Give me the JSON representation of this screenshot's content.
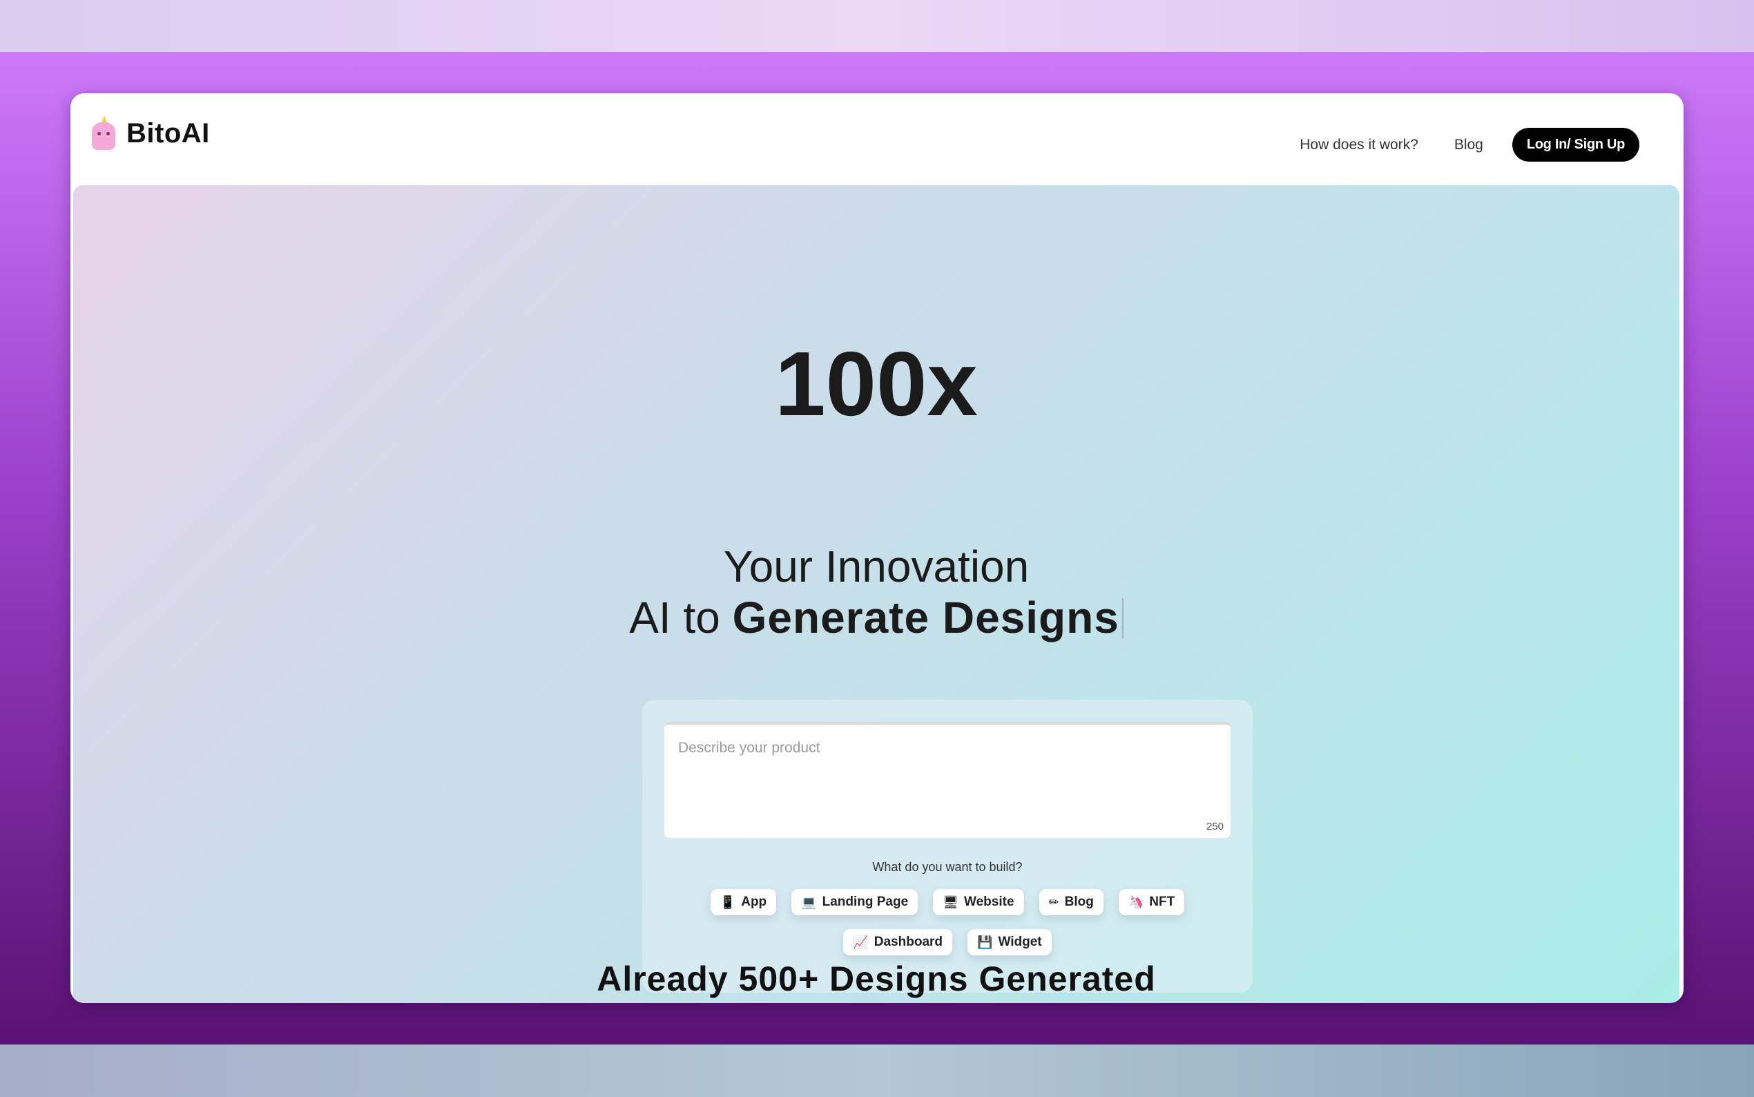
{
  "brand": {
    "name": "BitoAI",
    "logo_icon": "unicorn-icon"
  },
  "nav": {
    "links": [
      "How does it work?",
      "Blog"
    ],
    "login_label": "Log In/ Sign Up"
  },
  "hero": {
    "multiplier": "100x",
    "line1": "Your Innovation",
    "line2_prefix": "AI to",
    "line2_highlight": "Generate Designs"
  },
  "form": {
    "placeholder": "Describe your product",
    "char_counter": "250",
    "question": "What do you want to build?",
    "options_row1": [
      {
        "icon": "📱",
        "label": "App"
      },
      {
        "icon": "💻",
        "label": "Landing Page"
      },
      {
        "icon": "🖥",
        "label": "Website"
      },
      {
        "icon": "✏",
        "label": "Blog"
      },
      {
        "icon": "🦄",
        "label": "NFT"
      }
    ],
    "options_row2": [
      {
        "icon": "📈",
        "label": "Dashboard"
      },
      {
        "icon": "💾",
        "label": "Widget"
      }
    ]
  },
  "stats": {
    "headline": "Already 500+ Designs Generated"
  },
  "colors": {
    "frame_top": "#cd79fb",
    "frame_bottom": "#5a1273",
    "button_bg": "#000000",
    "hero_gradient_start": "#e8d4ea",
    "hero_gradient_end": "#a8ede7"
  }
}
